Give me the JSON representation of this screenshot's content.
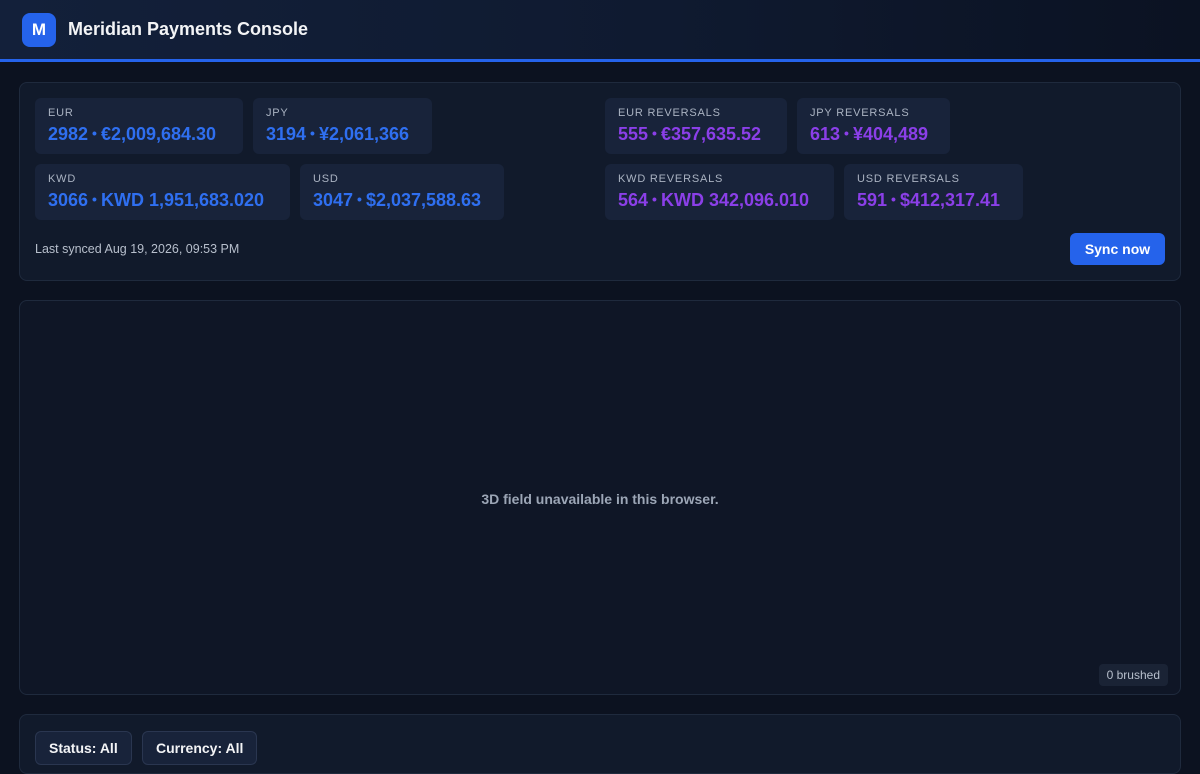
{
  "app": {
    "logo_letter": "M",
    "title": "Meridian Payments Console"
  },
  "summary": {
    "volume_cards": [
      {
        "label": "EUR",
        "count": "2982",
        "amount": "€2,009,684.30"
      },
      {
        "label": "JPY",
        "count": "3194",
        "amount": "¥2,061,366"
      },
      {
        "label": "KWD",
        "count": "3066",
        "amount": "KWD 1,951,683.020"
      },
      {
        "label": "USD",
        "count": "3047",
        "amount": "$2,037,588.63"
      }
    ],
    "reversal_cards": [
      {
        "label": "EUR REVERSALS",
        "count": "555",
        "amount": "€357,635.52"
      },
      {
        "label": "JPY REVERSALS",
        "count": "613",
        "amount": "¥404,489"
      },
      {
        "label": "KWD REVERSALS",
        "count": "564",
        "amount": "KWD 342,096.010"
      },
      {
        "label": "USD REVERSALS",
        "count": "591",
        "amount": "$412,317.41"
      }
    ],
    "separator": "•",
    "last_synced": "Last synced Aug 19, 2026, 09:53 PM",
    "sync_button": "Sync now"
  },
  "field": {
    "unavailable_message": "3D field unavailable in this browser.",
    "brushed_badge": "0 brushed"
  },
  "filters": {
    "status": "Status: All",
    "currency": "Currency: All"
  },
  "colors": {
    "accent": "#2563eb",
    "volume_value": "#2f6ff0",
    "reversal_value": "#8b3fe8"
  }
}
